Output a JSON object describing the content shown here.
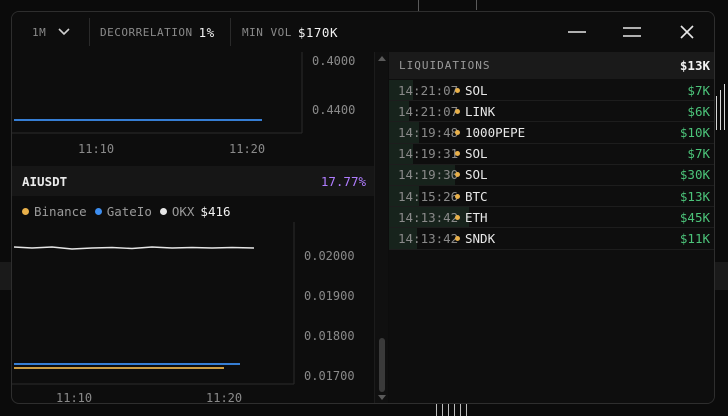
{
  "toolbar": {
    "timeframe": "1M",
    "decorrelation_label": "DECORRELATION",
    "decorrelation_value": "1%",
    "min_vol_label": "MIN VOL",
    "min_vol_value": "$170K"
  },
  "top_chart": {
    "y_labels": [
      "0.4000",
      "0.4400"
    ],
    "x_labels": [
      "11:10",
      "11:20"
    ]
  },
  "symbol": {
    "name": "AIUSDT",
    "change": "17.77%"
  },
  "legend": {
    "items": [
      {
        "name": "Binance",
        "color": "#e8b04a"
      },
      {
        "name": "GateIo",
        "color": "#3d8ef0"
      },
      {
        "name": "OKX",
        "color": "#e6e6e6"
      }
    ],
    "value": "$416"
  },
  "bottom_chart": {
    "y_labels": [
      "0.02000",
      "0.01900",
      "0.01800",
      "0.01700"
    ],
    "x_labels": [
      "11:10",
      "11:20"
    ]
  },
  "liquidations": {
    "title": "LIQUIDATIONS",
    "total": "$13K",
    "rows": [
      {
        "time": "14:21:07",
        "symbol": "SOL",
        "value": "$7K"
      },
      {
        "time": "14:21:07",
        "symbol": "LINK",
        "value": "$6K"
      },
      {
        "time": "14:19:48",
        "symbol": "1000PEPE",
        "value": "$10K"
      },
      {
        "time": "14:19:31",
        "symbol": "SOL",
        "value": "$7K"
      },
      {
        "time": "14:19:30",
        "symbol": "SOL",
        "value": "$30K"
      },
      {
        "time": "14:15:26",
        "symbol": "BTC",
        "value": "$13K"
      },
      {
        "time": "14:13:42",
        "symbol": "ETH",
        "value": "$45K"
      },
      {
        "time": "14:13:42",
        "symbol": "SNDK",
        "value": "$11K"
      }
    ]
  },
  "colors": {
    "accent_purple": "#b07cff",
    "liq_green": "#4cc47a",
    "binance": "#e8b04a",
    "gateio": "#3d8ef0",
    "okx": "#e6e6e6"
  }
}
